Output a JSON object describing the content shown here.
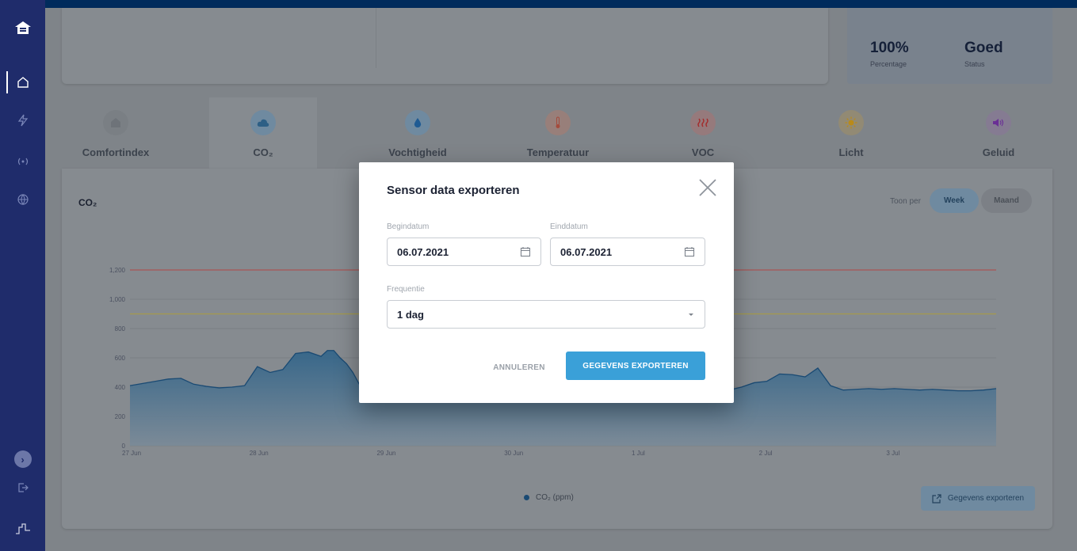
{
  "stats": [
    {
      "value": "100%",
      "label": "Percentage"
    },
    {
      "value": "Goed",
      "label": "Status"
    }
  ],
  "tabs": [
    {
      "label": "Comfortindex",
      "icon": "home-icon",
      "color": "#6e7379",
      "bg": "#7a7f84"
    },
    {
      "label": "CO₂",
      "icon": "cloud-icon",
      "color": "#2d5f85",
      "bg": "#6f8aa0"
    },
    {
      "label": "Vochtigheid",
      "icon": "droplet-icon",
      "color": "#1f5b93",
      "bg": "#6f8aa0"
    },
    {
      "label": "Temperatuur",
      "icon": "thermometer-icon",
      "color": "#a54b3c",
      "bg": "#987f7a"
    },
    {
      "label": "VOC",
      "icon": "heat-icon",
      "color": "#a42a2a",
      "bg": "#967a7c"
    },
    {
      "label": "Licht",
      "icon": "sun-icon",
      "color": "#b98a1a",
      "bg": "#928a74"
    },
    {
      "label": "Geluid",
      "icon": "speaker-icon",
      "color": "#6a2f95",
      "bg": "#857b92"
    }
  ],
  "chart": {
    "title": "CO₂",
    "toon_per": "Toon per",
    "week_label": "Week",
    "maand_label": "Maand",
    "legend": "CO₂ (ppm)",
    "export_label": "Gegevens exporteren"
  },
  "chart_data": {
    "type": "area",
    "ylim": [
      0,
      1400
    ],
    "yticks": [
      "0",
      "200",
      "400",
      "600",
      "800",
      "1,000",
      "1,200"
    ],
    "ytick_values": [
      0,
      200,
      400,
      600,
      800,
      1000,
      1200
    ],
    "xtick_labels": [
      "27 Jun",
      "28 Jun",
      "29 Jun",
      "30 Jun",
      "1 Jul",
      "2 Jul",
      "3 Jul"
    ],
    "xlim": [
      0,
      6.8
    ],
    "thresholds": [
      {
        "value": 1200,
        "color": "#a95555"
      },
      {
        "value": 900,
        "color": "#a59a4c"
      }
    ],
    "series": [
      {
        "name": "CO₂ (ppm)",
        "x": [
          0,
          0.1,
          0.2,
          0.3,
          0.4,
          0.5,
          0.6,
          0.7,
          0.8,
          0.9,
          1.0,
          1.1,
          1.2,
          1.3,
          1.4,
          1.5,
          1.55,
          1.6,
          1.65,
          1.7,
          1.75,
          1.8,
          1.9,
          2.0,
          2.1,
          2.2,
          2.3,
          4.7,
          4.8,
          4.9,
          5.0,
          5.1,
          5.2,
          5.3,
          5.4,
          5.45,
          5.5,
          5.6,
          5.7,
          5.8,
          5.9,
          6.0,
          6.1,
          6.2,
          6.3,
          6.4,
          6.5,
          6.6,
          6.7,
          6.8
        ],
        "values": [
          410,
          425,
          440,
          455,
          460,
          420,
          405,
          395,
          400,
          410,
          540,
          500,
          520,
          630,
          640,
          610,
          650,
          650,
          600,
          560,
          500,
          420,
          400,
          395,
          390,
          395,
          395,
          380,
          400,
          430,
          440,
          490,
          485,
          470,
          530,
          470,
          410,
          380,
          385,
          390,
          385,
          390,
          385,
          380,
          385,
          380,
          375,
          375,
          380,
          390
        ]
      }
    ]
  },
  "modal": {
    "title": "Sensor data exporteren",
    "begin_label": "Begindatum",
    "begin_value": "06.07.2021",
    "end_label": "Einddatum",
    "end_value": "06.07.2021",
    "freq_label": "Frequentie",
    "freq_value": "1 dag",
    "cancel_label": "ANNULEREN",
    "export_label": "GEGEVENS EXPORTEREN"
  }
}
